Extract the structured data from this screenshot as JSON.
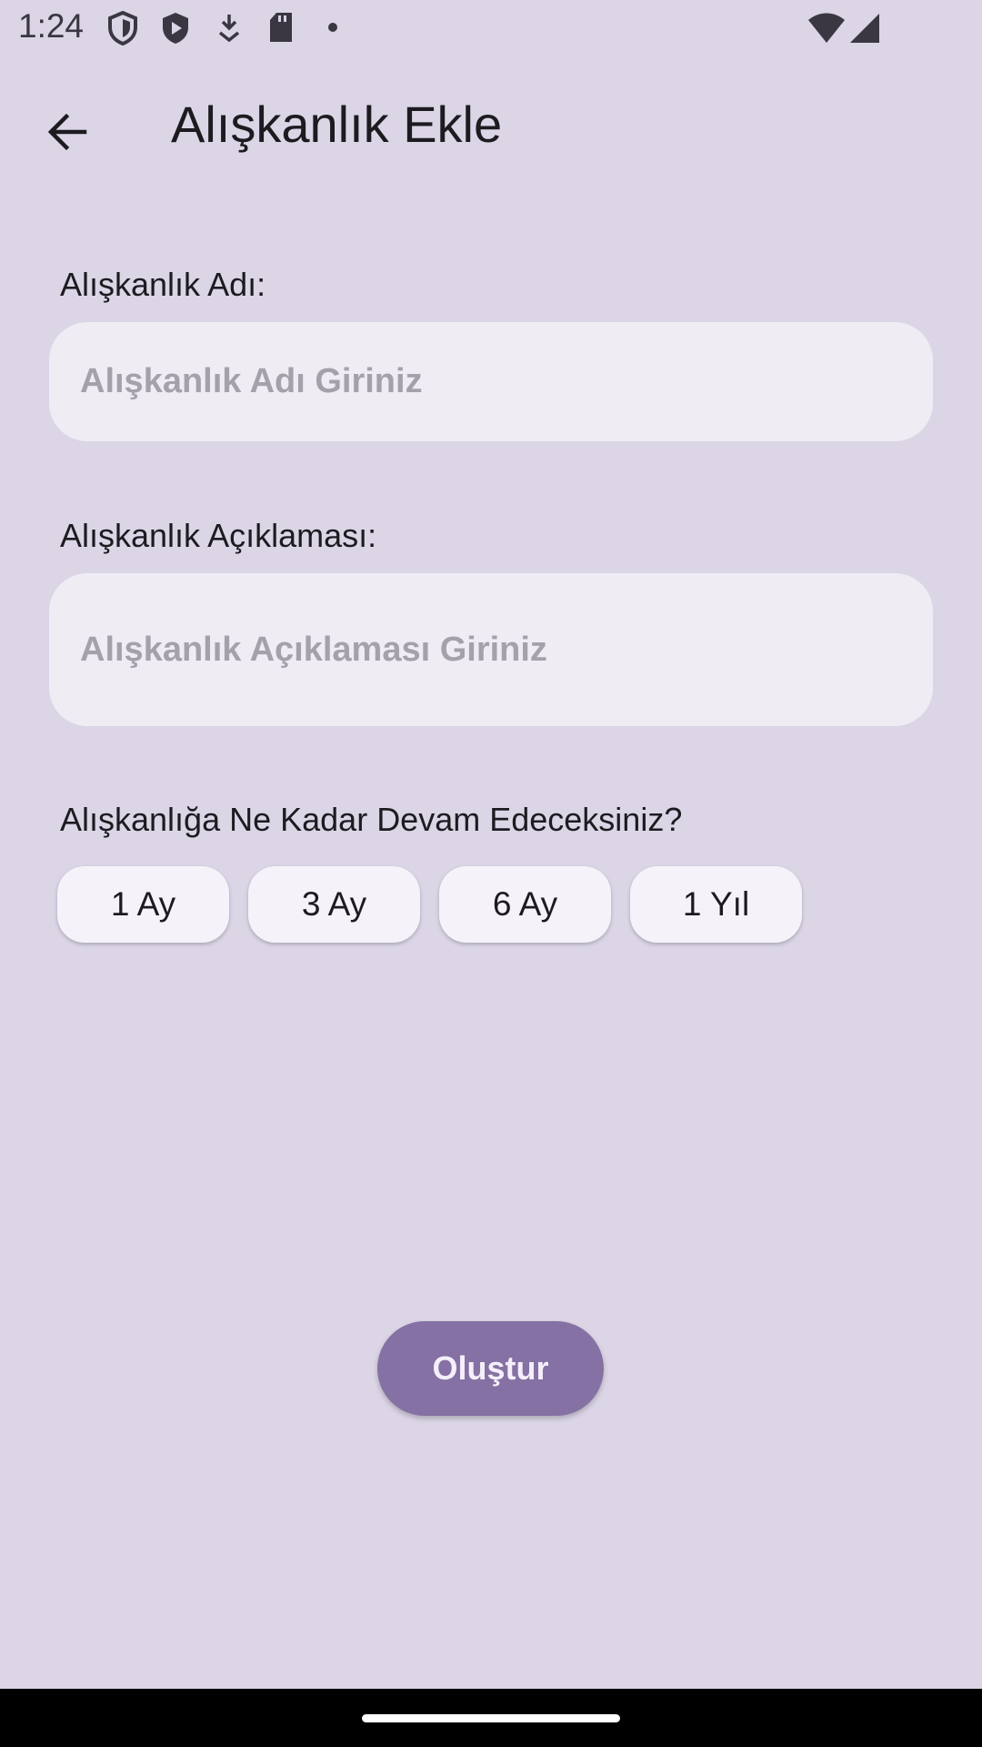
{
  "status_bar": {
    "time": "1:24",
    "icons": [
      "shield-icon",
      "play-protect-icon",
      "download-icon",
      "sd-card-icon",
      "dot-icon",
      "wifi-icon",
      "signal-icon"
    ]
  },
  "app_bar": {
    "back_icon": "arrow-back-icon",
    "title": "Alışkanlık Ekle"
  },
  "form": {
    "name": {
      "label": "Alışkanlık Adı:",
      "placeholder": "Alışkanlık Adı Giriniz",
      "value": ""
    },
    "description": {
      "label": "Alışkanlık Açıklaması:",
      "placeholder": "Alışkanlık Açıklaması Giriniz",
      "value": ""
    },
    "duration": {
      "question": "Alışkanlığa Ne Kadar Devam Edeceksiniz?",
      "options": [
        "1 Ay",
        "3 Ay",
        "6 Ay",
        "1 Yıl"
      ]
    },
    "submit_label": "Oluştur"
  },
  "colors": {
    "background": "#dbd5e6",
    "field_background": "#efecf4",
    "chip_background": "#f6f2fa",
    "primary_button": "#8571a3",
    "placeholder_text": "#a5a1aa"
  }
}
